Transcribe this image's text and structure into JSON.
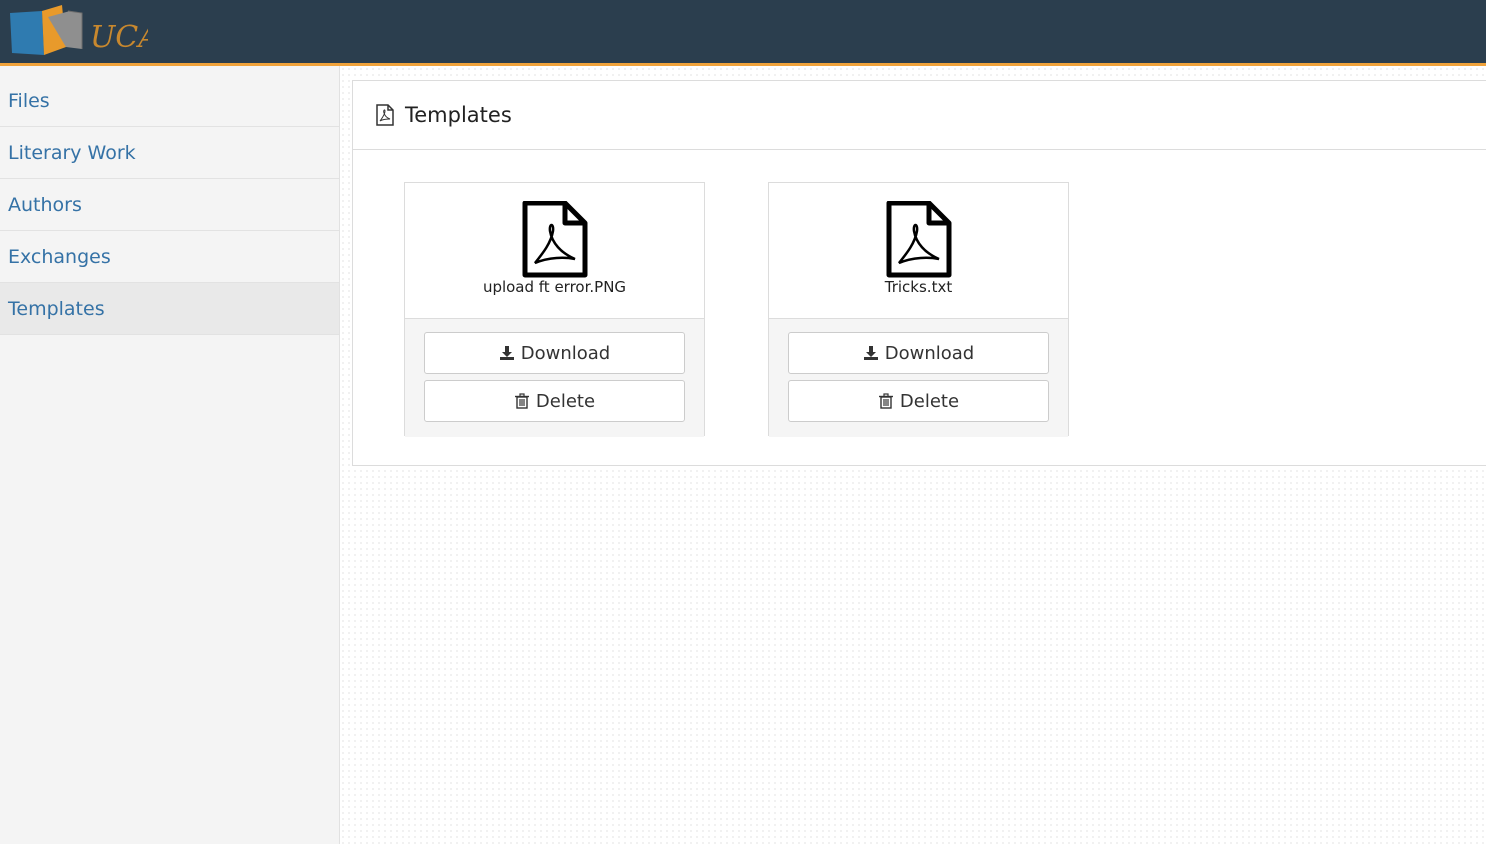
{
  "header": {
    "logo_text": "UCA",
    "accent_color": "#f0a23a",
    "bar_color": "#2b3e4e"
  },
  "sidebar": {
    "items": [
      {
        "label": "Files",
        "active": false
      },
      {
        "label": "Literary Work",
        "active": false
      },
      {
        "label": "Authors",
        "active": false
      },
      {
        "label": "Exchanges",
        "active": false
      },
      {
        "label": "Templates",
        "active": true
      }
    ]
  },
  "panel": {
    "title": "Templates",
    "icon": "pdf-file-icon"
  },
  "files": [
    {
      "name": "upload ft error.PNG",
      "icon": "pdf-file-icon",
      "download_label": "Download",
      "delete_label": "Delete"
    },
    {
      "name": "Tricks.txt",
      "icon": "pdf-file-icon",
      "download_label": "Download",
      "delete_label": "Delete"
    }
  ]
}
